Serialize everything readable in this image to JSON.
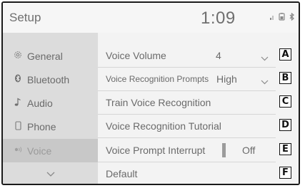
{
  "header": {
    "title": "Setup",
    "clock": "1:09",
    "status_icons": [
      "signal-icon",
      "battery-icon",
      "bluetooth-icon"
    ]
  },
  "sidebar": {
    "items": [
      {
        "label": "General",
        "icon": "gear-icon"
      },
      {
        "label": "Bluetooth",
        "icon": "bluetooth-icon"
      },
      {
        "label": "Audio",
        "icon": "music-note-icon"
      },
      {
        "label": "Phone",
        "icon": "phone-icon"
      },
      {
        "label": "Voice",
        "icon": "voice-icon",
        "active": true
      }
    ],
    "more_icon": "chevron-down-icon"
  },
  "settings": {
    "rows": [
      {
        "label": "Voice Volume",
        "value": "4",
        "callout": "A"
      },
      {
        "label": "Voice Recognition Prompts",
        "value": "High",
        "callout": "B"
      },
      {
        "label": "Train Voice Recognition",
        "callout": "C"
      },
      {
        "label": "Voice Recognition Tutorial",
        "callout": "D"
      },
      {
        "label": "Voice Prompt Interrupt",
        "value": "Off",
        "callout": "E"
      },
      {
        "label": "Default",
        "callout": "F"
      }
    ]
  },
  "colors": {
    "sidebar_bg": "#dcdcdc",
    "content_bg": "#f3f3f3",
    "text": "#6a6a6a"
  }
}
